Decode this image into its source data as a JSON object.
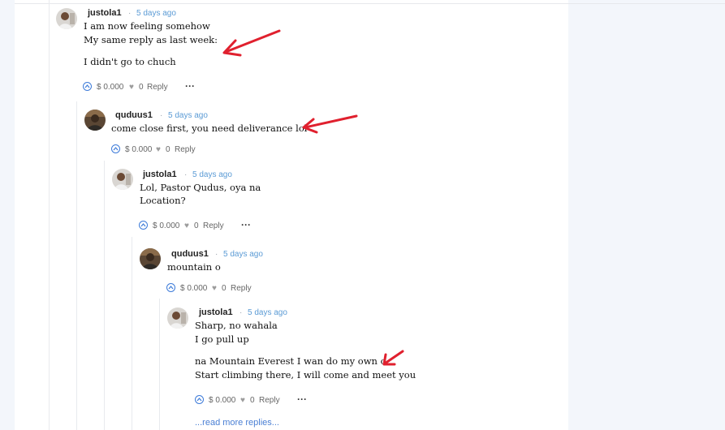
{
  "comments": [
    {
      "author": "justola1",
      "time": "5 days ago",
      "lines": [
        "I am now feeling somehow",
        "My same reply as last week:",
        "I didn't go to chuch"
      ],
      "amount": "$ 0.000",
      "likes": "0",
      "reply": "Reply"
    },
    {
      "author": "quduus1",
      "time": "5 days ago",
      "lines": [
        "come close first, you need deliverance lol"
      ],
      "amount": "$ 0.000",
      "likes": "0",
      "reply": "Reply"
    },
    {
      "author": "justola1",
      "time": "5 days ago",
      "lines": [
        "Lol, Pastor Qudus, oya na",
        "Location?"
      ],
      "amount": "$ 0.000",
      "likes": "0",
      "reply": "Reply"
    },
    {
      "author": "quduus1",
      "time": "5 days ago",
      "lines": [
        "mountain o"
      ],
      "amount": "$ 0.000",
      "likes": "0",
      "reply": "Reply"
    },
    {
      "author": "justola1",
      "time": "5 days ago",
      "lines": [
        "Sharp, no wahala",
        "I go pull up",
        "na Mountain Everest I wan do my own o",
        "Start climbing there, I will come and meet you"
      ],
      "amount": "$ 0.000",
      "likes": "0",
      "reply": "Reply"
    }
  ],
  "read_more": "...read more replies...",
  "icons": {
    "upvote": "upvote-circle-icon",
    "like": "heart-icon",
    "more": "more-dots-icon",
    "annotation": "red-arrow-annotation"
  },
  "colors": {
    "time": "#5b9bd5",
    "upvote": "#3d7bd9",
    "arrow": "#e0202e",
    "link": "#4a7fd4"
  }
}
